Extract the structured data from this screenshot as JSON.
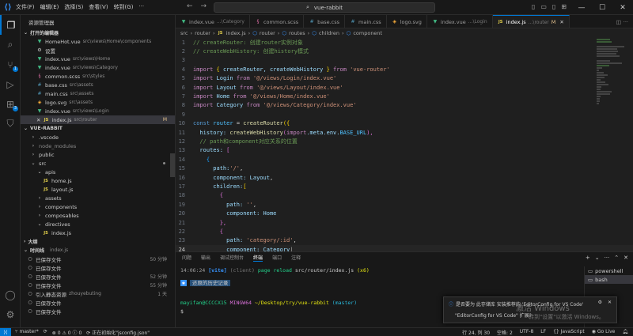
{
  "titlebar": {
    "menu": [
      "文件(F)",
      "编辑(E)",
      "选择(S)",
      "查看(V)",
      "转到(G)",
      "···"
    ],
    "search": "vue-rabbit"
  },
  "activity": {
    "icons": [
      "files-icon",
      "search-icon",
      "source-control-icon",
      "run-debug-icon",
      "extensions-icon",
      "remote-icon"
    ],
    "scm_badge": "1",
    "ext_badge": "3"
  },
  "sidebar": {
    "title": "资源管理器",
    "open_editors_title": "打开的编辑器",
    "open_editors": [
      {
        "name": "HomeHot.vue",
        "desc": "src\\views\\Home\\components",
        "type": "vue"
      },
      {
        "name": "设置",
        "desc": "",
        "type": "gear"
      },
      {
        "name": "index.vue",
        "desc": "src\\views\\Home",
        "type": "vue"
      },
      {
        "name": "index.vue",
        "desc": "src\\views\\Category",
        "type": "vue"
      },
      {
        "name": "common.scss",
        "desc": "src\\styles",
        "type": "scss"
      },
      {
        "name": "base.css",
        "desc": "src\\assets",
        "type": "css"
      },
      {
        "name": "main.css",
        "desc": "src\\assets",
        "type": "css"
      },
      {
        "name": "logo.svg",
        "desc": "src\\assets",
        "type": "svg"
      },
      {
        "name": "index.vue",
        "desc": "src\\views\\Login",
        "type": "vue"
      },
      {
        "name": "index.js",
        "desc": "src\\router",
        "type": "js",
        "selected": true,
        "badge": "M"
      }
    ],
    "project_title": "VUE-RABBIT",
    "tree": [
      {
        "name": ".vscode",
        "indent": 1,
        "arrow": "›"
      },
      {
        "name": "node_modules",
        "indent": 1,
        "arrow": "›",
        "dim": true
      },
      {
        "name": "public",
        "indent": 1,
        "arrow": "›"
      },
      {
        "name": "src",
        "indent": 1,
        "arrow": "⌄",
        "dot": true
      },
      {
        "name": "apis",
        "indent": 2,
        "arrow": "⌄"
      },
      {
        "name": "home.js",
        "indent": 3,
        "arrow": ""
      },
      {
        "name": "layout.js",
        "indent": 3,
        "arrow": ""
      },
      {
        "name": "assets",
        "indent": 2,
        "arrow": "›"
      },
      {
        "name": "components",
        "indent": 2,
        "arrow": "›"
      },
      {
        "name": "composables",
        "indent": 2,
        "arrow": "›"
      },
      {
        "name": "directives",
        "indent": 2,
        "arrow": "⌄"
      },
      {
        "name": "index.js",
        "indent": 3,
        "arrow": ""
      }
    ],
    "outline_title": "大纲",
    "timeline_title": "时间线",
    "timeline_file": "index.js",
    "timeline": [
      {
        "label": "已保存文件",
        "time": "50 分钟"
      },
      {
        "label": "已保存文件",
        "time": ""
      },
      {
        "label": "已保存文件",
        "time": "52 分钟"
      },
      {
        "label": "已保存文件",
        "time": "55 分钟"
      },
      {
        "label": "引入静态资源",
        "author": "zhouyebuting",
        "time": "1 天"
      },
      {
        "label": "已保存文件",
        "time": ""
      },
      {
        "label": "已保存文件",
        "time": ""
      }
    ]
  },
  "tabs": [
    {
      "name": "index.vue",
      "desc": "...\\Category",
      "type": "vue"
    },
    {
      "name": "common.scss",
      "desc": "",
      "type": "scss"
    },
    {
      "name": "base.css",
      "desc": "",
      "type": "css"
    },
    {
      "name": "main.css",
      "desc": "",
      "type": "css"
    },
    {
      "name": "logo.svg",
      "desc": "",
      "type": "svg"
    },
    {
      "name": "index.vue",
      "desc": "...\\Login",
      "type": "vue"
    },
    {
      "name": "index.js",
      "desc": "...\\router",
      "type": "js",
      "active": true,
      "badge": "M"
    }
  ],
  "breadcrumb": [
    "src",
    "router",
    "index.js",
    "router",
    "routes",
    "children",
    "component"
  ],
  "editor": {
    "current_line": 24,
    "lines": [
      {
        "n": 1,
        "t": [
          [
            "// createRouter: 创建router实例对象",
            "#6a9955"
          ]
        ]
      },
      {
        "n": 2,
        "t": [
          [
            "// createWebHistory: 创建history模式",
            "#6a9955"
          ]
        ]
      },
      {
        "n": 3,
        "t": []
      },
      {
        "n": 4,
        "t": [
          [
            "import ",
            "#c586c0"
          ],
          [
            "{ ",
            "#ffd700"
          ],
          [
            "createRouter, createWebHistory ",
            "#9cdcfe"
          ],
          [
            "} ",
            "#ffd700"
          ],
          [
            "from ",
            "#c586c0"
          ],
          [
            "'vue-router'",
            "#ce9178"
          ]
        ]
      },
      {
        "n": 5,
        "t": [
          [
            "import ",
            "#c586c0"
          ],
          [
            "Login ",
            "#9cdcfe"
          ],
          [
            "from ",
            "#c586c0"
          ],
          [
            "'@/views/Login/index.vue'",
            "#ce9178"
          ]
        ]
      },
      {
        "n": 6,
        "t": [
          [
            "import ",
            "#c586c0"
          ],
          [
            "Layout ",
            "#9cdcfe"
          ],
          [
            "from ",
            "#c586c0"
          ],
          [
            "'@/views/Layout/index.vue'",
            "#ce9178"
          ]
        ]
      },
      {
        "n": 7,
        "t": [
          [
            "import ",
            "#c586c0"
          ],
          [
            "Home ",
            "#9cdcfe"
          ],
          [
            "from ",
            "#c586c0"
          ],
          [
            "'@/views/Home/index.vue'",
            "#ce9178"
          ]
        ]
      },
      {
        "n": 8,
        "t": [
          [
            "import ",
            "#c586c0"
          ],
          [
            "Category ",
            "#9cdcfe"
          ],
          [
            "from ",
            "#c586c0"
          ],
          [
            "'@/views/Category/index.vue'",
            "#ce9178"
          ]
        ]
      },
      {
        "n": 9,
        "t": []
      },
      {
        "n": 10,
        "t": [
          [
            "const ",
            "#569cd6"
          ],
          [
            "router ",
            "#4fc1ff"
          ],
          [
            "= ",
            "#d4d4d4"
          ],
          [
            "createRouter",
            "#dcdcaa"
          ],
          [
            "({",
            "#ffd700"
          ]
        ]
      },
      {
        "n": 11,
        "t": [
          [
            "  history: ",
            "#9cdcfe"
          ],
          [
            "createWebHistory",
            "#dcdcaa"
          ],
          [
            "(",
            "#da70d6"
          ],
          [
            "import",
            "#c586c0"
          ],
          [
            ".meta.env.",
            "#9cdcfe"
          ],
          [
            "BASE_URL",
            "#4fc1ff"
          ],
          [
            "),",
            "#da70d6"
          ]
        ]
      },
      {
        "n": 12,
        "t": [
          [
            "  // path和component对应关系的位置",
            "#6a9955"
          ]
        ]
      },
      {
        "n": 13,
        "t": [
          [
            "  routes: ",
            "#9cdcfe"
          ],
          [
            "[",
            "#da70d6"
          ]
        ]
      },
      {
        "n": 14,
        "t": [
          [
            "    {",
            "#179fff"
          ]
        ]
      },
      {
        "n": 15,
        "t": [
          [
            "      path:",
            "#9cdcfe"
          ],
          [
            "'/'",
            "#ce9178"
          ],
          [
            ",",
            "#d4d4d4"
          ]
        ]
      },
      {
        "n": 16,
        "t": [
          [
            "      component: ",
            "#9cdcfe"
          ],
          [
            "Layout",
            "#9cdcfe"
          ],
          [
            ",",
            "#d4d4d4"
          ]
        ]
      },
      {
        "n": 17,
        "t": [
          [
            "      children:",
            "#9cdcfe"
          ],
          [
            "[",
            "#ffd700"
          ]
        ]
      },
      {
        "n": 18,
        "t": [
          [
            "        {",
            "#da70d6"
          ]
        ]
      },
      {
        "n": 19,
        "t": [
          [
            "          path: ",
            "#9cdcfe"
          ],
          [
            "''",
            "#ce9178"
          ],
          [
            ",",
            "#d4d4d4"
          ]
        ]
      },
      {
        "n": 20,
        "t": [
          [
            "          component: ",
            "#9cdcfe"
          ],
          [
            "Home",
            "#9cdcfe"
          ]
        ]
      },
      {
        "n": 21,
        "t": [
          [
            "        },",
            "#da70d6"
          ]
        ]
      },
      {
        "n": 22,
        "t": [
          [
            "        {",
            "#da70d6"
          ]
        ]
      },
      {
        "n": 23,
        "t": [
          [
            "          path: ",
            "#9cdcfe"
          ],
          [
            "'category/:id'",
            "#ce9178"
          ],
          [
            ",",
            "#d4d4d4"
          ]
        ]
      },
      {
        "n": 24,
        "t": [
          [
            "          component: ",
            "#9cdcfe"
          ],
          [
            "Category",
            "#9cdcfe"
          ]
        ]
      },
      {
        "n": 25,
        "t": [
          [
            "        }",
            "#da70d6"
          ]
        ]
      },
      {
        "n": 26,
        "t": [
          [
            "      ]",
            "#ffd700"
          ]
        ]
      },
      {
        "n": 27,
        "t": [
          [
            "    },",
            "#179fff"
          ]
        ]
      },
      {
        "n": 28,
        "t": [
          [
            "    {",
            "#179fff"
          ]
        ]
      }
    ]
  },
  "panel": {
    "tabs": [
      "问题",
      "输出",
      "调试控制台",
      "终端",
      "端口",
      "注释"
    ],
    "active_tab": "终端",
    "term_time": "14:06:24",
    "term_vite": "[vite]",
    "term_client": "(client)",
    "term_msg": "page reload",
    "term_file": "src/router/index.js",
    "term_count": "(x6)",
    "restored": "还原的历史记录",
    "prompt_user": "mayifan@CCCCX15",
    "prompt_env": "MINGW64",
    "prompt_path": "~/Desktop/try/vue-rabbit",
    "prompt_branch": "(master)",
    "prompt_char": "$",
    "terminals": [
      "powershell",
      "bash"
    ]
  },
  "toast": {
    "text": "是否要为 此存储库 安装推荐的 'EditorConfig for VS Code'",
    "text2": "\"EditorConfig for VS Code\" 扩展?",
    "watermark": "激活 Windows",
    "watermark2": "转到\"设置\"以激活 Windows。"
  },
  "status": {
    "branch": "master*",
    "errors": "0",
    "warnings": "0",
    "info": "0",
    "init": "正在初始化\"jsconfig.json\"",
    "position": "行 24, 列 30",
    "spaces": "空格: 2",
    "encoding": "UTF-8",
    "eol": "LF",
    "lang": "JavaScript",
    "golive": "Go Live"
  },
  "colors": {
    "accent": "#0078d4",
    "vue": "#41b883",
    "js": "#e8d44d",
    "scss": "#cd6799",
    "css": "#519aba",
    "svg": "#ffb13b"
  }
}
